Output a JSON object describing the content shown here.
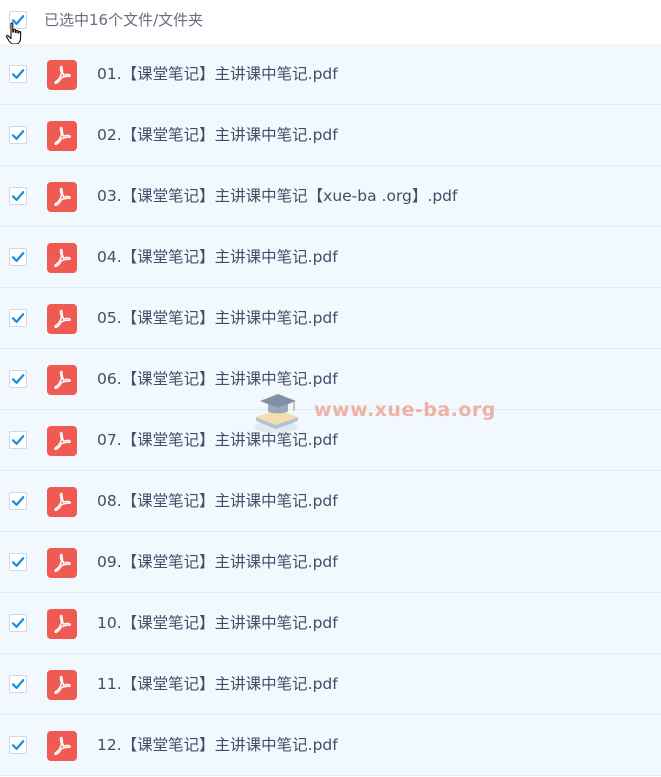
{
  "header": {
    "select_label": "已选中16个文件/文件夹",
    "all_checked": true
  },
  "files": [
    {
      "name": "01.【课堂笔记】主讲课中笔记.pdf",
      "checked": true,
      "icon": "pdf-icon"
    },
    {
      "name": "02.【课堂笔记】主讲课中笔记.pdf",
      "checked": true,
      "icon": "pdf-icon"
    },
    {
      "name": "03.【课堂笔记】主讲课中笔记【xue-ba .org】.pdf",
      "checked": true,
      "icon": "pdf-icon"
    },
    {
      "name": "04.【课堂笔记】主讲课中笔记.pdf",
      "checked": true,
      "icon": "pdf-icon"
    },
    {
      "name": "05.【课堂笔记】主讲课中笔记.pdf",
      "checked": true,
      "icon": "pdf-icon"
    },
    {
      "name": "06.【课堂笔记】主讲课中笔记.pdf",
      "checked": true,
      "icon": "pdf-icon"
    },
    {
      "name": "07.【课堂笔记】主讲课中笔记.pdf",
      "checked": true,
      "icon": "pdf-icon"
    },
    {
      "name": "08.【课堂笔记】主讲课中笔记.pdf",
      "checked": true,
      "icon": "pdf-icon"
    },
    {
      "name": "09.【课堂笔记】主讲课中笔记.pdf",
      "checked": true,
      "icon": "pdf-icon"
    },
    {
      "name": "10.【课堂笔记】主讲课中笔记.pdf",
      "checked": true,
      "icon": "pdf-icon"
    },
    {
      "name": "11.【课堂笔记】主讲课中笔记.pdf",
      "checked": true,
      "icon": "pdf-icon"
    },
    {
      "name": "12.【课堂笔记】主讲课中笔记.pdf",
      "checked": true,
      "icon": "pdf-icon"
    }
  ],
  "watermark": {
    "text": "www.xue-ba.org"
  },
  "colors": {
    "check": "#1d8fe0",
    "pdf_red": "#ef5a52",
    "row_bg": "#f1f8fe",
    "row_border": "#e1ebf5",
    "text": "#424e67"
  }
}
